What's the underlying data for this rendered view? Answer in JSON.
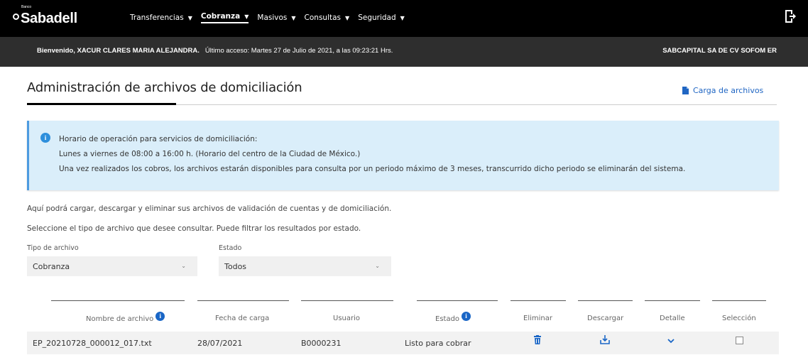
{
  "brand": {
    "banco": "Banco",
    "name": "Sabadell"
  },
  "nav": {
    "items": [
      {
        "label": "Transferencias"
      },
      {
        "label": "Cobranza"
      },
      {
        "label": "Masivos"
      },
      {
        "label": "Consultas"
      },
      {
        "label": "Seguridad"
      }
    ]
  },
  "welcome": {
    "greeting": "Bienvenido, XACUR CLARES MARIA ALEJANDRA.",
    "last_access": "Último acceso: Martes 27 de Julio de 2021, a las 09:23:21 Hrs.",
    "company": "SABCAPITAL SA DE CV SOFOM ER"
  },
  "page": {
    "title": "Administración de archivos de domiciliación",
    "upload_link": "Carga de archivos"
  },
  "info": {
    "line1": "Horario de operación para servicios de domiciliación:",
    "line2": "Lunes a viernes de 08:00 a 16:00 h. (Horario del centro de la Ciudad de México.)",
    "line3": "Una vez realizados los cobros, los archivos estarán disponibles para consulta por un periodo máximo de 3 meses, transcurrido dicho periodo se eliminarán del sistema."
  },
  "instructions": {
    "p1": "Aquí podrá cargar, descargar y eliminar sus archivos de validación de cuentas y de domiciliación.",
    "p2": "Seleccione el tipo de archivo que desee consultar. Puede filtrar los resultados por estado."
  },
  "filters": {
    "tipo_label": "Tipo de archivo",
    "tipo_value": "Cobranza",
    "estado_label": "Estado",
    "estado_value": "Todos"
  },
  "table": {
    "headers": {
      "nombre": "Nombre de archivo",
      "fecha": "Fecha de carga",
      "usuario": "Usuario",
      "estado": "Estado",
      "eliminar": "Eliminar",
      "descargar": "Descargar",
      "detalle": "Detalle",
      "seleccion": "Selección"
    },
    "rows": [
      {
        "nombre": "EP_20210728_000012_017.txt",
        "fecha": "28/07/2021",
        "usuario": "B0000231",
        "estado": "Listo para cobrar",
        "selected": false
      }
    ]
  },
  "colors": {
    "topbar": "#000000",
    "welcome_bar": "#2e2e2e",
    "accent_blue": "#1a66c6",
    "info_bg": "#daeefa"
  },
  "icons": {
    "logout": "logout-icon",
    "upload": "file-icon",
    "info": "info-icon",
    "delete": "trash-icon",
    "download": "download-icon",
    "detail": "chevron-down-icon"
  }
}
